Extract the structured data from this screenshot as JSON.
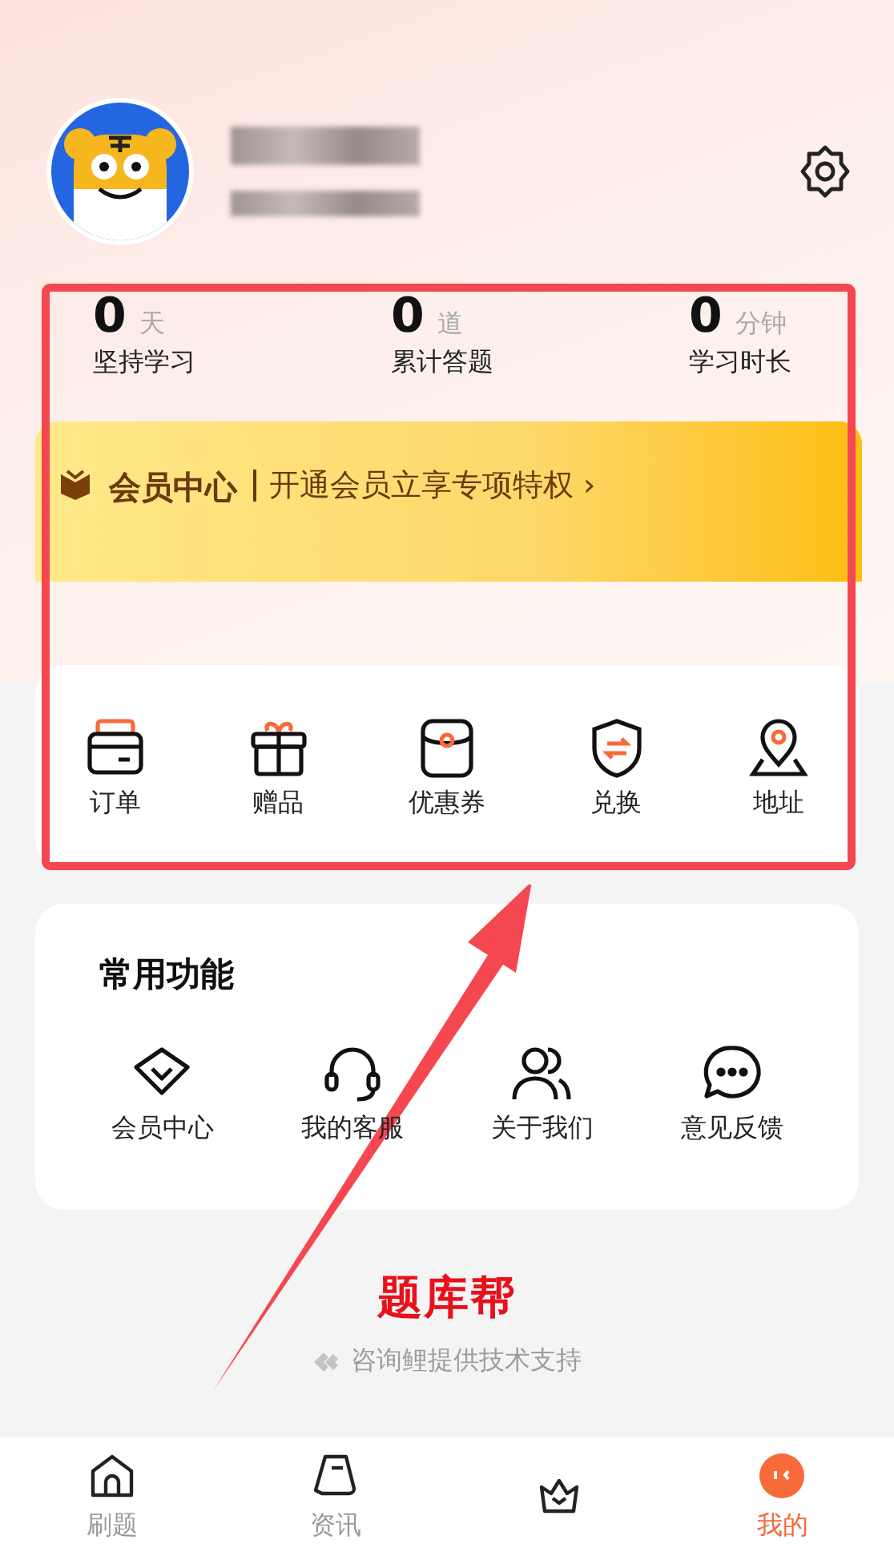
{
  "stats": [
    {
      "value": "0",
      "unit": "天",
      "label": "坚持学习"
    },
    {
      "value": "0",
      "unit": "道",
      "label": "累计答题"
    },
    {
      "value": "0",
      "unit": "分钟",
      "label": "学习时长"
    }
  ],
  "member_banner": {
    "title": "会员中心",
    "subtitle": "开通会员立享专项特权",
    "chevron": "›"
  },
  "shortcuts": [
    {
      "kind": "order",
      "label": "订单"
    },
    {
      "kind": "gift",
      "label": "赠品"
    },
    {
      "kind": "coupon",
      "label": "优惠券"
    },
    {
      "kind": "exchange",
      "label": "兑换"
    },
    {
      "kind": "address",
      "label": "地址"
    }
  ],
  "common": {
    "title": "常用功能",
    "items": [
      {
        "kind": "vip",
        "label": "会员中心"
      },
      {
        "kind": "service",
        "label": "我的客服"
      },
      {
        "kind": "about",
        "label": "关于我们"
      },
      {
        "kind": "feedback",
        "label": "意见反馈"
      }
    ]
  },
  "footer": {
    "logo": "题库帮",
    "support": "咨询鲤提供技术支持"
  },
  "tabs": [
    {
      "kind": "home",
      "label": "刷题",
      "selected": false
    },
    {
      "kind": "news",
      "label": "资讯",
      "selected": false
    },
    {
      "kind": "crown",
      "selected": false
    },
    {
      "kind": "me",
      "label": "我的",
      "selected": true
    }
  ],
  "annotation_overlay": true
}
